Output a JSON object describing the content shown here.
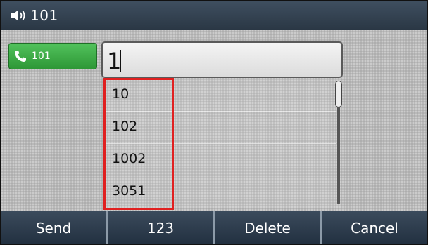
{
  "status_bar": {
    "title": "101",
    "icon": "speaker-icon"
  },
  "line_key": {
    "label": "101",
    "icon": "phone-handset-icon",
    "color": "#3fae48"
  },
  "dial_input": {
    "value": "1"
  },
  "suggestions": {
    "items": [
      "10",
      "102",
      "1002",
      "3051"
    ]
  },
  "highlight": {
    "color": "#e02020"
  },
  "softkeys": {
    "send": "Send",
    "mode": "123",
    "delete": "Delete",
    "cancel": "Cancel"
  }
}
